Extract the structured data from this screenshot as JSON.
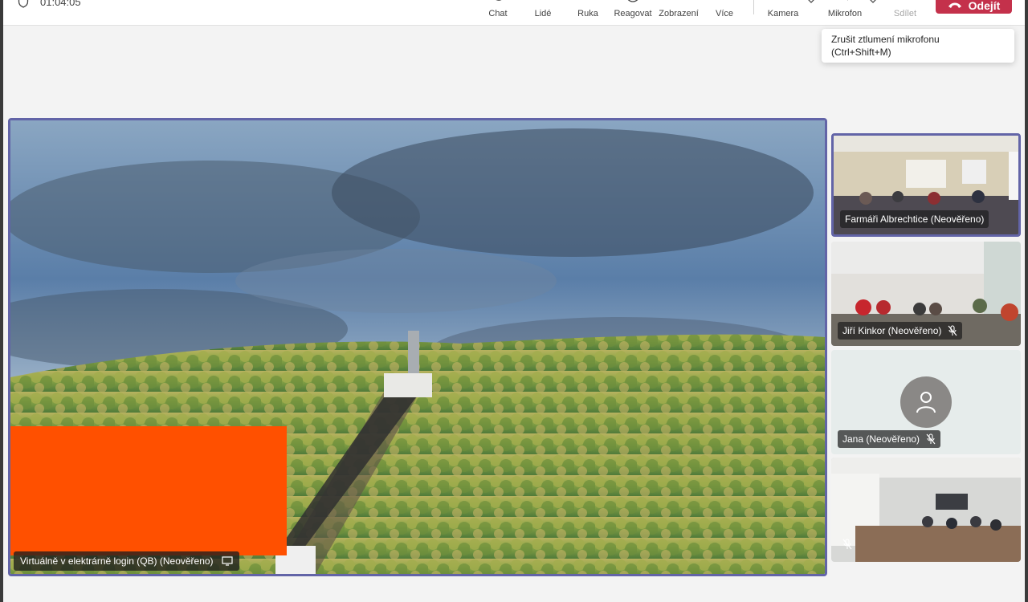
{
  "meeting": {
    "timer": "01:04:05"
  },
  "toolbar": {
    "chat": "Chat",
    "people": "Lidé",
    "hand": "Ruka",
    "react": "Reagovat",
    "view": "Zobrazení",
    "more": "Více",
    "camera": "Kamera",
    "mic": "Mikrofon",
    "share": "Sdílet",
    "leave": "Odejít"
  },
  "tooltip": {
    "line1": "Zrušit ztlumení mikrofonu",
    "line2": "(Ctrl+Shift+M)"
  },
  "stage": {
    "presenter": "Virtuálně v elektrárně login (QB) (Neověřeno)"
  },
  "participants": [
    {
      "name": "Farmáři Albrechtice (Neověřeno)"
    },
    {
      "name": "Jiří Kinkor (Neověřeno)"
    },
    {
      "name": "Jana (Neověřeno)"
    },
    {
      "name": ""
    }
  ],
  "colors": {
    "accent": "#6264a7",
    "leave": "#c4314b",
    "redaction": "#ff5000",
    "background": "#f3f3f3"
  }
}
